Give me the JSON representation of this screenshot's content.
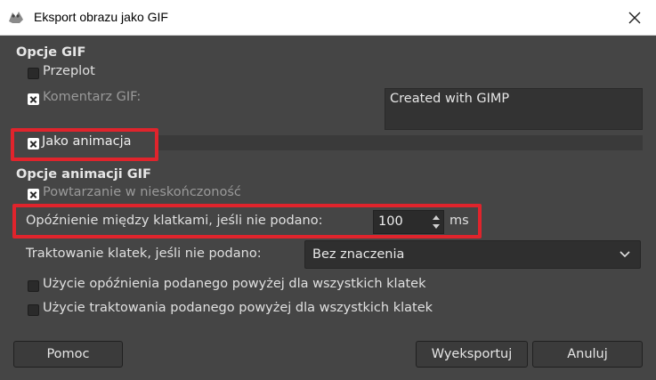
{
  "window": {
    "title": "Eksport obrazu jako GIF"
  },
  "gif_options": {
    "heading": "Opcje GIF",
    "interlace_label": "Przeplot",
    "comment_label": "Komentarz GIF:",
    "comment_value": "Created with GIMP",
    "as_animation_label": "Jako animacja"
  },
  "animation_options": {
    "heading": "Opcje animacji GIF",
    "loop_label": "Powtarzanie w nieskończoność",
    "delay_label": "Opóźnienie między klatkami, jeśli nie podano:",
    "delay_value": "100",
    "delay_unit": "ms",
    "disposal_label": "Traktowanie klatek, jeśli nie podano:",
    "disposal_value": "Bez znaczenia",
    "use_delay_all_label": "Użycie opóźnienia podanego powyżej dla wszystkich klatek",
    "use_disposal_all_label": "Użycie traktowania podanego powyżej dla wszystkich klatek"
  },
  "checkbox_states": {
    "interlace": false,
    "comment": true,
    "as_animation": true,
    "loop": true,
    "use_delay_all": false,
    "use_disposal_all": false
  },
  "buttons": {
    "help": "Pomoc",
    "export": "Wyeksportuj",
    "cancel": "Anuluj"
  },
  "colors": {
    "highlight": "#e0242c",
    "background": "#454545"
  }
}
